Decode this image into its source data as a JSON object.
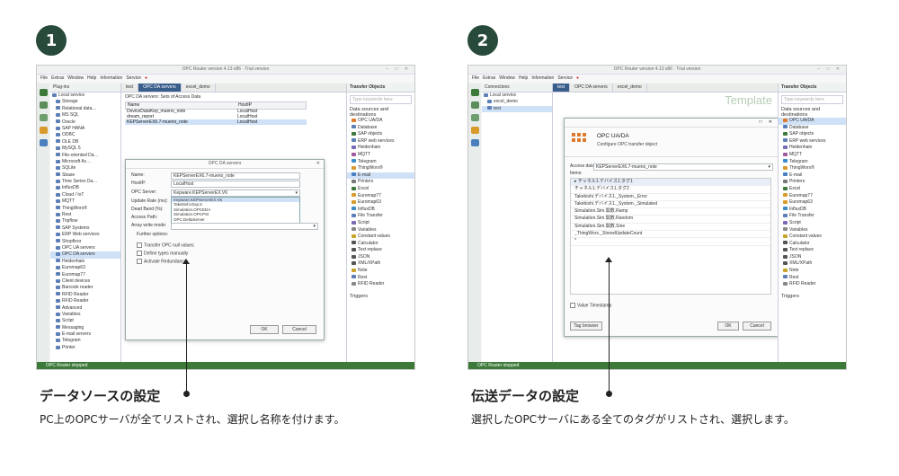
{
  "panels": [
    {
      "badge": "1",
      "app_title": "OPC Router version 4.13 x86 · Trial version",
      "menu": [
        "File",
        "Extras",
        "Window",
        "Help",
        "Information",
        "Service"
      ],
      "tree": {
        "header": "Plug-ins",
        "items": [
          "Local service",
          "Storage",
          "Relational data…",
          "MS SQL",
          "Oracle",
          "SAP HANA",
          "ODBC",
          "OLE DB",
          "MySQL 5",
          "File-oriented Da…",
          "Microsoft Ac…",
          "SQLite",
          "Sbase",
          "Time Series Da…",
          "InfluxDB",
          "Cloud / IoT",
          "MQTT",
          "ThingWorx®",
          "Rest",
          "Tripflow",
          "SAP Systems",
          "ERP Web services",
          "Shopfloor",
          "OPC UA servers",
          "OPC DA servers",
          "Heidenhain",
          "Euromap63",
          "Euromap77",
          "Client devices",
          "Barcode reader",
          "RFID Reader",
          "RFID Reader",
          "Advanced",
          "Variables",
          "Script",
          "Messaging",
          "E-mail servers",
          "Telegram",
          "Printer"
        ],
        "selected": 24
      },
      "tabs": [
        "test",
        "OPC DA servers",
        "excel_demo"
      ],
      "active_tab": 1,
      "list_heading": "OPC DA servers: Sets of Access Data",
      "columns": [
        "Name",
        "HostIP"
      ],
      "rows": [
        [
          "DeviceDataKep_mueno_note",
          "LocalHost"
        ],
        [
          "dream_report",
          "LocalHost"
        ],
        [
          "KEPServerEX6.7-mueno_note",
          "LocalHost"
        ]
      ],
      "dialog": {
        "title": "OPC DA servers",
        "fields": [
          {
            "label": "Name:",
            "value": "KEPServerEX6.7-mueno_note"
          },
          {
            "label": "HostIP:",
            "value": "LocalHost"
          },
          {
            "label": "OPC Server:",
            "value": "Kepware.KEPServerEX.V6"
          },
          {
            "label": "Update Rate (ms):",
            "value": ""
          },
          {
            "label": "Dead Band (%):",
            "value": ""
          },
          {
            "label": "Access Path:",
            "value": ""
          },
          {
            "label": "Array write mode:",
            "value": ""
          }
        ],
        "dropdown_options": [
          "Kepware.KEPServerEX.V6",
          "Takebishi.Dxp.5",
          "Simulation.OPCEDA",
          "Simulation.OPCPSI",
          "OPC.DeltaServer",
          "Takebishi.DxpAe.5"
        ],
        "further_options": "Further options:",
        "checkboxes": [
          "Transfer OPC null values",
          "Define types manually",
          "Activate Redundancy"
        ],
        "ok": "OK",
        "cancel": "Cancel"
      },
      "right_panel": {
        "header": "Transfer Objects",
        "search": "Type keywords here",
        "title": "Data sources and destinations",
        "items": [
          "OPC UA/DA",
          "Database",
          "SAP objects",
          "ERP web services",
          "Heidenhain",
          "MQTT",
          "Telegram",
          "ThingWorx®",
          "E-mail",
          "Printers",
          "Excel",
          "Euromap77",
          "Euromap63",
          "InfluxDB",
          "File Transfer",
          "Script",
          "Variables",
          "Constant values",
          "Calculator",
          "Text replace",
          "JSON",
          "XML/XPath",
          "Note",
          "Rest",
          "RFID Reader"
        ],
        "selected": 8,
        "footer": "Triggers"
      },
      "status": "OPC Router stopped",
      "caption_title": "データソースの設定",
      "caption_body": "PC上のOPCサーバが全てリストされ、選択し名称を付けます。"
    },
    {
      "badge": "2",
      "app_title": "OPC Router version 4.13 x86 · Trial version",
      "menu": [
        "File",
        "Extras",
        "Window",
        "Help",
        "Information",
        "Service"
      ],
      "tree": {
        "header": "Connections",
        "items": [
          "Local service",
          "excel_demo",
          "test"
        ],
        "selected": 2
      },
      "tabs": [
        "test",
        "OPC DA servers",
        "excel_demo"
      ],
      "active_tab": 0,
      "template_label": "Template",
      "dialog": {
        "heading": "OPC UA/DA",
        "subheading": "Configure OPC transfer object",
        "access_label": "Access data:",
        "access_value": "KEPServerEX6.7-mueno_note",
        "items_label": "Items:",
        "tags": [
          "チャネル1.デバイス1.タグ1",
          "チャネル1.デバイス1.タグ2",
          "Takebishi.デバイス1._System._Error",
          "Takebishi.デバイス1._System._Simulated",
          "Simulation.Sim.関数.Ramp",
          "Simulation.Sim.関数.Random",
          "Simulation.Sim.関数.Sine",
          "_ThingWorx._StoredUpdateCount"
        ],
        "timestamp_checkbox": "Value Timestamp",
        "tag_browser": "Tag browser",
        "ok": "OK",
        "cancel": "Cancel"
      },
      "right_panel": {
        "header": "Transfer Objects",
        "search": "Type keywords here",
        "title": "Data sources and destinations",
        "items": [
          "OPC UA/DA",
          "Database",
          "SAP objects",
          "ERP web services",
          "Heidenhain",
          "MQTT",
          "Telegram",
          "ThingWorx®",
          "E-mail",
          "Printers",
          "Excel",
          "Euromap77",
          "Euromap63",
          "InfluxDB",
          "File Transfer",
          "Script",
          "Variables",
          "Constant values",
          "Calculator",
          "Text replace",
          "JSON",
          "XML/XPath",
          "Note",
          "Rest",
          "RFID Reader"
        ],
        "selected": 0,
        "footer": "Triggers"
      },
      "status": "OPC Router stopped",
      "caption_title": "伝送データの設定",
      "caption_body": "選択したOPCサーバにある全てのタグがリストされ、選択します。"
    }
  ],
  "colors": {
    "badge": "#274a3a",
    "status_bar": "#3d7a3a",
    "active_tab": "#3a5e8c",
    "selection": "#cfe1f7"
  }
}
